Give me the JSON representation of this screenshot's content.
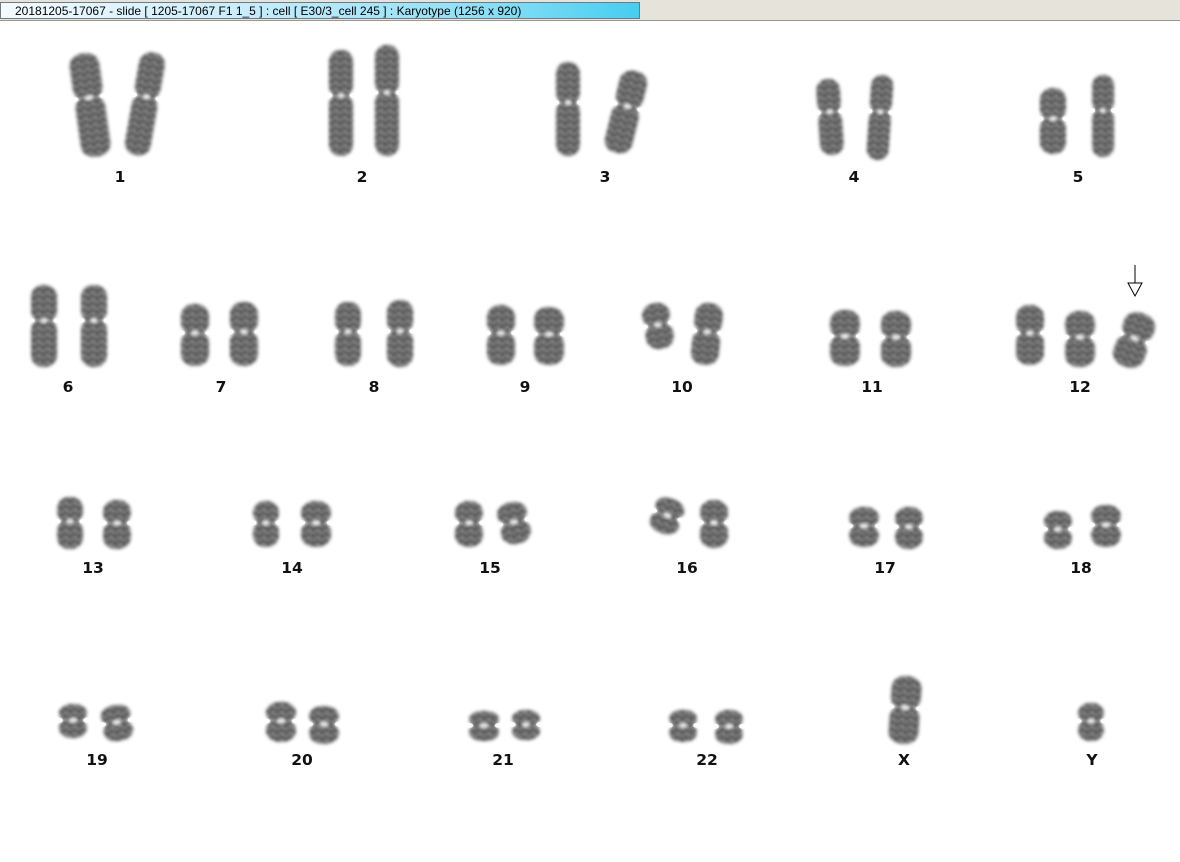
{
  "window": {
    "title": "20181205-17067 - slide [ 1205-17067 F1 1_5 ] : cell [ E30/3_cell 245 ] : Karyotype  (1256 x 920)"
  },
  "karyotype": {
    "chromosomes": [
      {
        "label": "1"
      },
      {
        "label": "2"
      },
      {
        "label": "3"
      },
      {
        "label": "4"
      },
      {
        "label": "5"
      },
      {
        "label": "6"
      },
      {
        "label": "7"
      },
      {
        "label": "8"
      },
      {
        "label": "9"
      },
      {
        "label": "10"
      },
      {
        "label": "11"
      },
      {
        "label": "12"
      },
      {
        "label": "13"
      },
      {
        "label": "14"
      },
      {
        "label": "15"
      },
      {
        "label": "16"
      },
      {
        "label": "17"
      },
      {
        "label": "18"
      },
      {
        "label": "19"
      },
      {
        "label": "20"
      },
      {
        "label": "21"
      },
      {
        "label": "22"
      },
      {
        "label": "X"
      },
      {
        "label": "Y"
      }
    ],
    "marker": {
      "icon": "down-arrow-icon",
      "chromosome": "12"
    }
  }
}
